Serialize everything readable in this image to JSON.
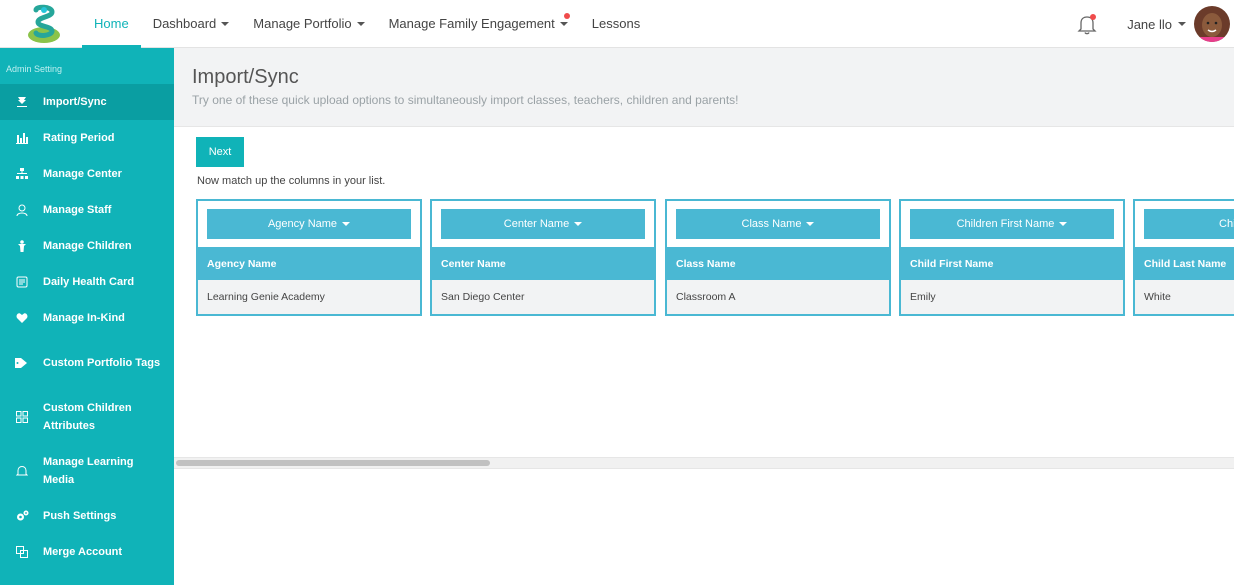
{
  "nav": {
    "items": [
      {
        "label": "Home",
        "caret": false
      },
      {
        "label": "Dashboard",
        "caret": true
      },
      {
        "label": "Manage Portfolio",
        "caret": true
      },
      {
        "label": "Manage Family Engagement",
        "caret": true
      },
      {
        "label": "Lessons",
        "caret": false
      }
    ],
    "user_name": "Jane llo",
    "accent": "#10b3b8"
  },
  "sidebar": {
    "section_label": "Admin Setting",
    "items": [
      {
        "label": "Import/Sync",
        "icon": "import-icon"
      },
      {
        "label": "Rating Period",
        "icon": "bar-chart-icon"
      },
      {
        "label": "Manage Center",
        "icon": "sitemap-icon"
      },
      {
        "label": "Manage Staff",
        "icon": "staff-icon"
      },
      {
        "label": "Manage Children",
        "icon": "child-icon"
      },
      {
        "label": "Daily Health Card",
        "icon": "health-card-icon"
      },
      {
        "label": "Manage In-Kind",
        "icon": "heart-icon"
      },
      {
        "label": "Custom Portfolio Tags",
        "icon": "tags-icon"
      },
      {
        "label": "Custom Children Attributes",
        "icon": "grid-icon"
      },
      {
        "label": "Manage Learning Media",
        "icon": "bell-icon"
      },
      {
        "label": "Push Settings",
        "icon": "gears-icon"
      },
      {
        "label": "Merge Account",
        "icon": "merge-icon"
      }
    ]
  },
  "page": {
    "title": "Import/Sync",
    "subtitle": "Try one of these quick upload options to simultaneously import classes, teachers, children and parents!"
  },
  "content": {
    "next_label": "Next",
    "match_text": "Now match up the columns in your list.",
    "columns": [
      {
        "select": "Agency Name",
        "header": "Agency Name",
        "value": "Learning Genie Academy"
      },
      {
        "select": "Center Name",
        "header": "Center Name",
        "value": "San Diego Center"
      },
      {
        "select": "Class Name",
        "header": "Class Name",
        "value": "Classroom A"
      },
      {
        "select": "Children First Name",
        "header": "Child First Name",
        "value": "Emily"
      },
      {
        "select": "Children",
        "header": "Child Last Name",
        "value": "White"
      }
    ]
  }
}
